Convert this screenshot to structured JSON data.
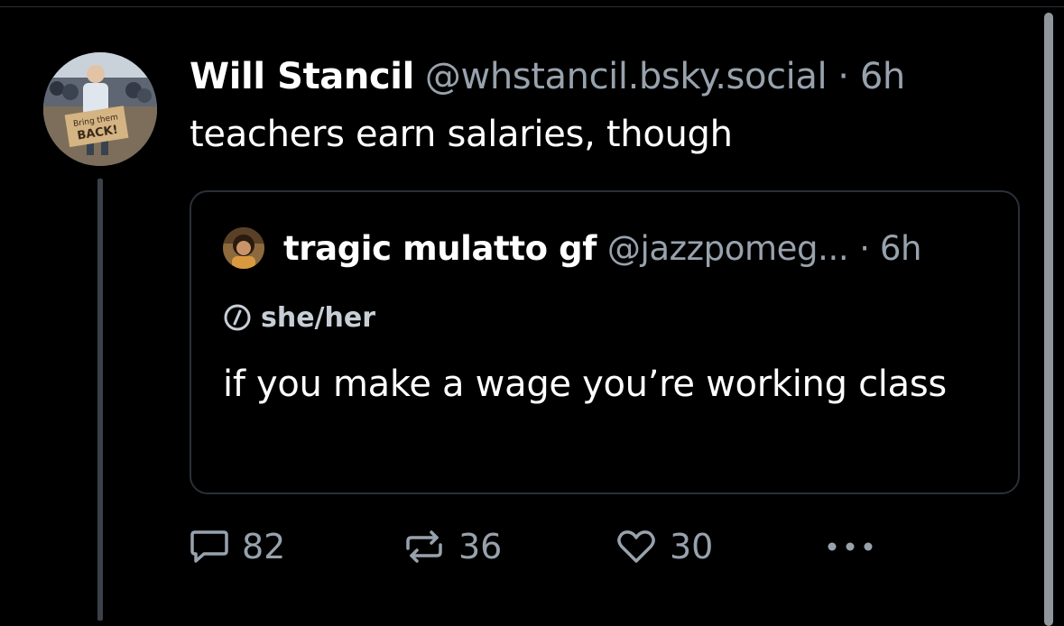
{
  "post": {
    "author_name": "Will Stancil",
    "author_handle": "@whstancil.bsky.social",
    "time": "· 6h",
    "text": "teachers earn salaries, though",
    "avatar_sign": [
      "Bring them",
      "BACK!"
    ]
  },
  "quote": {
    "author_name": "tragic mulatto gf",
    "author_handle": "@jazzpomeg...",
    "time": "· 6h",
    "pronouns": "she/her",
    "text": "if you make a wage you’re working class"
  },
  "actions": {
    "reply_count": "82",
    "repost_count": "36",
    "like_count": "30"
  },
  "icons": {
    "reply": "comment-icon",
    "repost": "repost-icon",
    "like": "heart-icon",
    "more": "more-icon"
  },
  "colors": {
    "background": "#000000",
    "muted_text": "#98a2ad",
    "border": "#2a3038",
    "thread_line": "#3a4148"
  }
}
